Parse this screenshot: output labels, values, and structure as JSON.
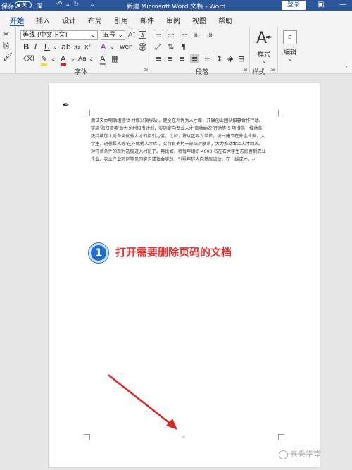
{
  "titlebar": {
    "save_label": "保存",
    "toggle_label": "关",
    "title": "新建 Microsoft Word 文档 - Word",
    "login_label": "登录"
  },
  "tabs": [
    {
      "label": "开始"
    },
    {
      "label": "插入"
    },
    {
      "label": "设计"
    },
    {
      "label": "布局"
    },
    {
      "label": "引用"
    },
    {
      "label": "邮件"
    },
    {
      "label": "审阅"
    },
    {
      "label": "视图"
    },
    {
      "label": "帮助"
    }
  ],
  "ribbon": {
    "font_name": "等线 (中文正文)",
    "font_size": "五号",
    "group_font": "字体",
    "group_paragraph": "段落",
    "group_style": "样式",
    "styles_label": "样式",
    "edit_label": "编辑"
  },
  "document": {
    "lines": [
      "测试文本明确组建'乡村振兴指导站'，健全在外优秀人才库，开展创业团队招募合作行动。",
      "实施'海归育英'助力乡村招引计划，实施定向专业人才'直收纳农'行动等 5 项措施，推动各",
      "级持续加大对各类优秀人才的招引力度。比如，将以区县为单位，统一建立在外企业家、大",
      "学生、退役军人等'在外优秀人才库'，实行县乡村干部结对联系，大力推动本土人才回流。",
      "对符合条件的及时选拔进入村班子。再比如，将每年组织 4000 名左右大学生志愿者到农业",
      "企业、农业产业园区等见习实习或社会实践，引导年轻人向基层流动，在一线成才。↵"
    ]
  },
  "annotation": {
    "step_number": "1",
    "step_text": "打开需要删除页码的文档"
  },
  "page_number_mark": "↵",
  "watermark": "卷卷学堂"
}
